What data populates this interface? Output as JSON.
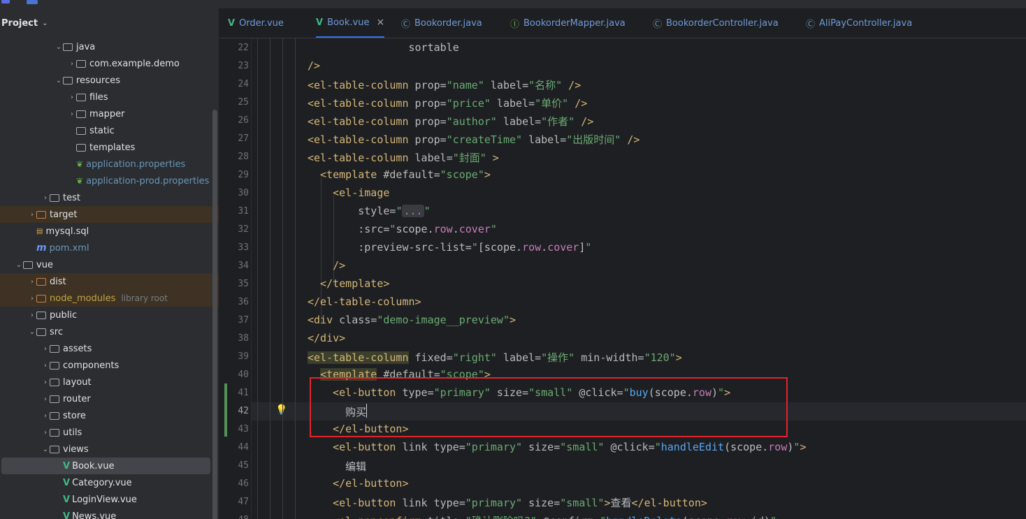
{
  "project": {
    "title": "Project",
    "tree": [
      {
        "label": "java",
        "arrow": "⌄",
        "indent": 81,
        "icon": "folder-src",
        "style": "normal"
      },
      {
        "label": "com.example.demo",
        "arrow": "›",
        "indent": 100,
        "icon": "package",
        "style": "normal"
      },
      {
        "label": "resources",
        "arrow": "⌄",
        "indent": 81,
        "icon": "folder-res",
        "style": "normal"
      },
      {
        "label": "files",
        "arrow": "›",
        "indent": 100,
        "icon": "folder",
        "style": "normal"
      },
      {
        "label": "mapper",
        "arrow": "›",
        "indent": 100,
        "icon": "folder",
        "style": "normal"
      },
      {
        "label": "static",
        "arrow": "",
        "indent": 100,
        "icon": "folder",
        "style": "normal"
      },
      {
        "label": "templates",
        "arrow": "",
        "indent": 100,
        "icon": "folder",
        "style": "normal"
      },
      {
        "label": "application.properties",
        "arrow": "",
        "indent": 100,
        "icon": "leaf",
        "style": "blue"
      },
      {
        "label": "application-prod.properties",
        "arrow": "",
        "indent": 100,
        "icon": "leaf",
        "style": "blue"
      },
      {
        "label": "test",
        "arrow": "›",
        "indent": 62,
        "icon": "folder",
        "style": "normal"
      },
      {
        "label": "target",
        "arrow": "›",
        "indent": 43,
        "icon": "folder-orange",
        "style": "excluded"
      },
      {
        "label": "mysql.sql",
        "arrow": "",
        "indent": 43,
        "icon": "sql",
        "style": "normal"
      },
      {
        "label": "pom.xml",
        "arrow": "",
        "indent": 43,
        "icon": "maven",
        "style": "blue"
      },
      {
        "label": "vue",
        "arrow": "⌄",
        "indent": 24,
        "icon": "folder",
        "style": "normal"
      },
      {
        "label": "dist",
        "arrow": "›",
        "indent": 43,
        "icon": "folder-orange",
        "style": "excluded"
      },
      {
        "label": "node_modules",
        "arrow": "›",
        "indent": 43,
        "icon": "folder-orange",
        "style": "excluded-gold",
        "hint": "library root"
      },
      {
        "label": "public",
        "arrow": "›",
        "indent": 43,
        "icon": "folder",
        "style": "normal"
      },
      {
        "label": "src",
        "arrow": "⌄",
        "indent": 43,
        "icon": "folder",
        "style": "normal"
      },
      {
        "label": "assets",
        "arrow": "›",
        "indent": 62,
        "icon": "folder",
        "style": "normal"
      },
      {
        "label": "components",
        "arrow": "›",
        "indent": 62,
        "icon": "folder",
        "style": "normal"
      },
      {
        "label": "layout",
        "arrow": "›",
        "indent": 62,
        "icon": "folder",
        "style": "normal"
      },
      {
        "label": "router",
        "arrow": "›",
        "indent": 62,
        "icon": "folder",
        "style": "normal"
      },
      {
        "label": "store",
        "arrow": "›",
        "indent": 62,
        "icon": "folder",
        "style": "normal"
      },
      {
        "label": "utils",
        "arrow": "›",
        "indent": 62,
        "icon": "folder",
        "style": "normal"
      },
      {
        "label": "views",
        "arrow": "⌄",
        "indent": 62,
        "icon": "folder",
        "style": "normal"
      },
      {
        "label": "Book.vue",
        "arrow": "",
        "indent": 81,
        "icon": "vue",
        "style": "selected"
      },
      {
        "label": "Category.vue",
        "arrow": "",
        "indent": 81,
        "icon": "vue",
        "style": "normal"
      },
      {
        "label": "LoginView.vue",
        "arrow": "",
        "indent": 81,
        "icon": "vue",
        "style": "normal"
      },
      {
        "label": "News.vue",
        "arrow": "",
        "indent": 81,
        "icon": "vue",
        "style": "normal"
      }
    ]
  },
  "tabs": [
    {
      "label": "Order.vue",
      "icon": "vue-icon",
      "active": false
    },
    {
      "label": "Book.vue",
      "icon": "vue-icon",
      "active": true,
      "close": "×"
    },
    {
      "label": "Bookorder.java",
      "icon": "class-icon",
      "active": false
    },
    {
      "label": "BookorderMapper.java",
      "icon": "interface-icon",
      "active": false
    },
    {
      "label": "BookorderController.java",
      "icon": "class-icon",
      "active": false
    },
    {
      "label": "AliPayController.java",
      "icon": "class-icon",
      "active": false
    }
  ],
  "editor": {
    "current_line": 42,
    "lines": [
      {
        "n": 22,
        "indent": 8,
        "segs": [
          [
            "pu",
            "                sortable"
          ]
        ]
      },
      {
        "n": 23,
        "indent": 0,
        "segs": [
          [
            "tg",
            "/>"
          ]
        ]
      },
      {
        "n": 24,
        "indent": 0,
        "segs": [
          [
            "tg",
            "<el-table-column"
          ],
          [
            "at",
            " prop"
          ],
          [
            "pu",
            "="
          ],
          [
            "st",
            "\"name\""
          ],
          [
            "at",
            " label"
          ],
          [
            "pu",
            "="
          ],
          [
            "st",
            "\"名称\""
          ],
          [
            "tg",
            " />"
          ]
        ]
      },
      {
        "n": 25,
        "indent": 0,
        "segs": [
          [
            "tg",
            "<el-table-column"
          ],
          [
            "at",
            " prop"
          ],
          [
            "pu",
            "="
          ],
          [
            "st",
            "\"price\""
          ],
          [
            "at",
            " label"
          ],
          [
            "pu",
            "="
          ],
          [
            "st",
            "\"单价\""
          ],
          [
            "tg",
            " />"
          ]
        ]
      },
      {
        "n": 26,
        "indent": 0,
        "segs": [
          [
            "tg",
            "<el-table-column"
          ],
          [
            "at",
            " prop"
          ],
          [
            "pu",
            "="
          ],
          [
            "st",
            "\"author\""
          ],
          [
            "at",
            " label"
          ],
          [
            "pu",
            "="
          ],
          [
            "st",
            "\"作者\""
          ],
          [
            "tg",
            " />"
          ]
        ]
      },
      {
        "n": 27,
        "indent": 0,
        "segs": [
          [
            "tg",
            "<el-table-column"
          ],
          [
            "at",
            " prop"
          ],
          [
            "pu",
            "="
          ],
          [
            "st",
            "\"createTime\""
          ],
          [
            "at",
            " label"
          ],
          [
            "pu",
            "="
          ],
          [
            "st",
            "\"出版时间\""
          ],
          [
            "tg",
            " />"
          ]
        ]
      },
      {
        "n": 28,
        "indent": 0,
        "segs": [
          [
            "tg",
            "<el-table-column"
          ],
          [
            "at",
            " label"
          ],
          [
            "pu",
            "="
          ],
          [
            "st",
            "\"封面\""
          ],
          [
            "tg",
            " >"
          ]
        ]
      },
      {
        "n": 29,
        "indent": 0,
        "segs": [
          [
            "tg",
            "  <template"
          ],
          [
            "at",
            " #default"
          ],
          [
            "pu",
            "="
          ],
          [
            "st",
            "\"scope\""
          ],
          [
            "tg",
            ">"
          ]
        ]
      },
      {
        "n": 30,
        "indent": 0,
        "segs": [
          [
            "tg",
            "    <el-image"
          ]
        ]
      },
      {
        "n": 31,
        "indent": 0,
        "segs": [
          [
            "at",
            "        style"
          ],
          [
            "pu",
            "="
          ],
          [
            "st",
            "\""
          ],
          [
            "fold",
            "..."
          ],
          [
            "st",
            "\""
          ]
        ]
      },
      {
        "n": 32,
        "indent": 0,
        "segs": [
          [
            "at",
            "        :src"
          ],
          [
            "pu",
            "="
          ],
          [
            "st",
            "\""
          ],
          [
            "pu",
            "scope."
          ],
          [
            "pr",
            "row"
          ],
          [
            "pu",
            "."
          ],
          [
            "pr",
            "cover"
          ],
          [
            "st",
            "\""
          ]
        ]
      },
      {
        "n": 33,
        "indent": 0,
        "segs": [
          [
            "at",
            "        :preview-src-list"
          ],
          [
            "pu",
            "="
          ],
          [
            "st",
            "\""
          ],
          [
            "pu",
            "[scope."
          ],
          [
            "pr",
            "row"
          ],
          [
            "pu",
            "."
          ],
          [
            "pr",
            "cover"
          ],
          [
            "pu",
            "]"
          ],
          [
            "st",
            "\""
          ]
        ]
      },
      {
        "n": 34,
        "indent": 0,
        "segs": [
          [
            "tg",
            "    />"
          ]
        ]
      },
      {
        "n": 35,
        "indent": 0,
        "segs": [
          [
            "tg",
            "  </template>"
          ]
        ]
      },
      {
        "n": 36,
        "indent": 0,
        "segs": [
          [
            "tg",
            "</el-table-column>"
          ]
        ]
      },
      {
        "n": 37,
        "indent": 0,
        "segs": [
          [
            "tg",
            "<div"
          ],
          [
            "at",
            " class"
          ],
          [
            "pu",
            "="
          ],
          [
            "st",
            "\"demo-image__preview\""
          ],
          [
            "tg",
            ">"
          ]
        ]
      },
      {
        "n": 38,
        "indent": 0,
        "segs": [
          [
            "tg",
            "</div>"
          ]
        ]
      },
      {
        "n": 39,
        "indent": 0,
        "segs": [
          [
            "hl",
            "<el-table-column"
          ],
          [
            "at",
            " fixed"
          ],
          [
            "pu",
            "="
          ],
          [
            "st",
            "\"right\""
          ],
          [
            "at",
            " label"
          ],
          [
            "pu",
            "="
          ],
          [
            "st",
            "\"操作\""
          ],
          [
            "at",
            " min-width"
          ],
          [
            "pu",
            "="
          ],
          [
            "st",
            "\"120\""
          ],
          [
            "tg",
            ">"
          ]
        ]
      },
      {
        "n": 40,
        "indent": 0,
        "segs": [
          [
            "pu",
            "  "
          ],
          [
            "hl",
            "<template"
          ],
          [
            "at",
            " #default"
          ],
          [
            "pu",
            "="
          ],
          [
            "st",
            "\"scope\""
          ],
          [
            "tg",
            ">"
          ]
        ]
      },
      {
        "n": 41,
        "indent": 0,
        "segs": [
          [
            "tg",
            "    <el-button"
          ],
          [
            "at",
            " type"
          ],
          [
            "pu",
            "="
          ],
          [
            "st",
            "\"primary\""
          ],
          [
            "at",
            " size"
          ],
          [
            "pu",
            "="
          ],
          [
            "st",
            "\"small\""
          ],
          [
            "at",
            " @click"
          ],
          [
            "pu",
            "="
          ],
          [
            "st",
            "\""
          ],
          [
            "fn",
            "buy"
          ],
          [
            "pu",
            "(scope."
          ],
          [
            "pr",
            "row"
          ],
          [
            "pu",
            ")"
          ],
          [
            "st",
            "\""
          ],
          [
            "tg",
            ">"
          ]
        ]
      },
      {
        "n": 42,
        "indent": 0,
        "segs": [
          [
            "pu",
            "      购买"
          ]
        ]
      },
      {
        "n": 43,
        "indent": 0,
        "segs": [
          [
            "tg",
            "    </el-button>"
          ]
        ]
      },
      {
        "n": 44,
        "indent": 0,
        "segs": [
          [
            "tg",
            "    <el-button"
          ],
          [
            "at",
            " link type"
          ],
          [
            "pu",
            "="
          ],
          [
            "st",
            "\"primary\""
          ],
          [
            "at",
            " size"
          ],
          [
            "pu",
            "="
          ],
          [
            "st",
            "\"small\""
          ],
          [
            "at",
            " @click"
          ],
          [
            "pu",
            "="
          ],
          [
            "st",
            "\""
          ],
          [
            "fn",
            "handleEdit"
          ],
          [
            "pu",
            "(scope."
          ],
          [
            "pr",
            "row"
          ],
          [
            "pu",
            ")"
          ],
          [
            "st",
            "\""
          ],
          [
            "tg",
            ">"
          ]
        ]
      },
      {
        "n": 45,
        "indent": 0,
        "segs": [
          [
            "pu",
            "      编辑"
          ]
        ]
      },
      {
        "n": 46,
        "indent": 0,
        "segs": [
          [
            "tg",
            "    </el-button>"
          ]
        ]
      },
      {
        "n": 47,
        "indent": 0,
        "segs": [
          [
            "tg",
            "    <el-button"
          ],
          [
            "at",
            " link type"
          ],
          [
            "pu",
            "="
          ],
          [
            "st",
            "\"primary\""
          ],
          [
            "at",
            " size"
          ],
          [
            "pu",
            "="
          ],
          [
            "st",
            "\"small\""
          ],
          [
            "tg",
            ">"
          ],
          [
            "pu",
            "查看"
          ],
          [
            "tg",
            "</el-button>"
          ]
        ]
      },
      {
        "n": 48,
        "indent": 0,
        "segs": [
          [
            "tg",
            "    <el-popconfirm"
          ],
          [
            "at",
            " title"
          ],
          [
            "pu",
            "="
          ],
          [
            "st",
            "\"确认删除吗?\""
          ],
          [
            "at",
            " @confirm"
          ],
          [
            "pu",
            "="
          ],
          [
            "st",
            "\""
          ],
          [
            "fn",
            "handleDelete"
          ],
          [
            "pu",
            "(scope."
          ],
          [
            "pr",
            "row"
          ],
          [
            "pu",
            ".id)"
          ],
          [
            "st",
            "\""
          ],
          [
            "tg",
            ">"
          ]
        ]
      }
    ]
  }
}
